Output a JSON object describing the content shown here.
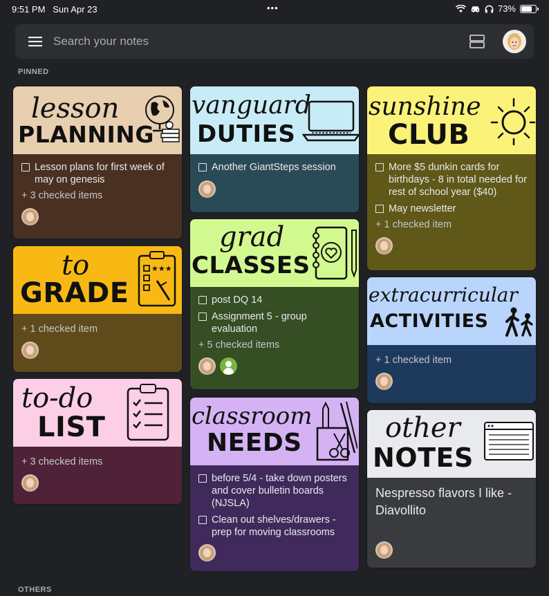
{
  "status": {
    "time": "9:51 PM",
    "date": "Sun Apr 23",
    "battery": "73%",
    "battery_level": 0.73
  },
  "search": {
    "placeholder": "Search your notes"
  },
  "sections": {
    "pinned": "PINNED",
    "others": "OTHERS"
  },
  "notes": {
    "lesson": {
      "script": "lesson",
      "block": "PLANNING",
      "items": [
        "Lesson plans for first week of may on genesis"
      ],
      "checked": "+ 3 checked items",
      "colors": {
        "banner": "#e7cfb0",
        "body": "#4a3020"
      }
    },
    "vanguard": {
      "script": "vanguard",
      "block": "DUTIES",
      "items": [
        "Another GiantSteps session"
      ],
      "colors": {
        "banner": "#c8ecf7",
        "body": "#2b4a57"
      }
    },
    "sunshine": {
      "script": "sunshine",
      "block": "CLUB",
      "items": [
        "More $5 dunkin cards for birthdays - 8 in total needed for rest of school year ($40)",
        "May newsletter"
      ],
      "checked": "+ 1 checked item",
      "colors": {
        "banner": "#fbf27a",
        "body": "#5f5818"
      }
    },
    "grade": {
      "script": "to",
      "block": "GRADE",
      "checked": "+ 1 checked item",
      "colors": {
        "banner": "#f9b914",
        "body": "#5f4a1c"
      }
    },
    "grad": {
      "script": "grad",
      "block": "CLASSES",
      "items": [
        "post DQ 14",
        "Assignment 5 - group evaluation"
      ],
      "checked": "+ 5 checked items",
      "colors": {
        "banner": "#d2f98f",
        "body": "#354e23"
      }
    },
    "extra": {
      "script": "extracurricular",
      "block": "ACTIVITIES",
      "checked": "+ 1 checked item",
      "colors": {
        "banner": "#b9d5fb",
        "body": "#1d3a5c"
      }
    },
    "todo": {
      "script": "to-do",
      "block": "LIST",
      "checked": "+ 3 checked items",
      "colors": {
        "banner": "#fccfe6",
        "body": "#4f2238"
      }
    },
    "classroom": {
      "script": "classroom",
      "block": "NEEDS",
      "items": [
        "before 5/4 - take down posters and cover bulletin boards (NJSLA)",
        "Clean out shelves/drawers - prep for moving classrooms"
      ],
      "colors": {
        "banner": "#d4b2f4",
        "body": "#402a5c"
      }
    },
    "other": {
      "script": "other",
      "block": "NOTES",
      "text": "Nespresso flavors I like - Diavollito",
      "colors": {
        "banner": "#e8eaed",
        "body": "#3a3b3e"
      }
    }
  }
}
